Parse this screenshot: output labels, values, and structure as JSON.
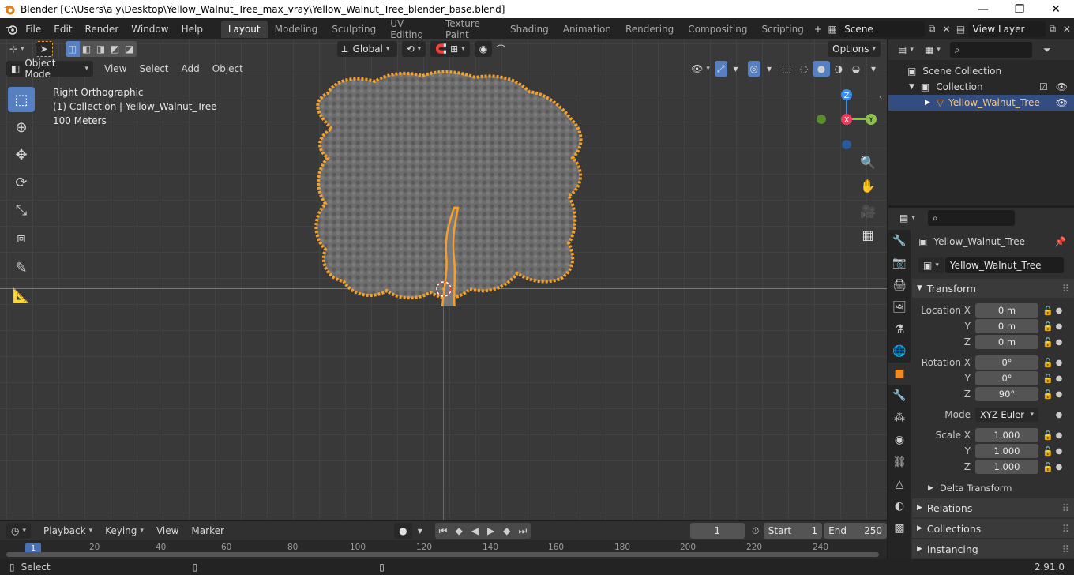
{
  "window": {
    "title": "Blender [C:\\Users\\a y\\Desktop\\Yellow_Walnut_Tree_max_vray\\Yellow_Walnut_Tree_blender_base.blend]",
    "minimize": "—",
    "maximize": "❐",
    "close": "✕"
  },
  "menu": [
    "File",
    "Edit",
    "Render",
    "Window",
    "Help"
  ],
  "workspaces": [
    "Layout",
    "Modeling",
    "Sculpting",
    "UV Editing",
    "Texture Paint",
    "Shading",
    "Animation",
    "Rendering",
    "Compositing",
    "Scripting"
  ],
  "scene": {
    "label": "Scene",
    "view_layer": "View Layer"
  },
  "viewport": {
    "mode": "Object Mode",
    "menus": [
      "View",
      "Select",
      "Add",
      "Object"
    ],
    "transform_orientation": "Global",
    "options": "Options",
    "view_name": "Right Orthographic",
    "collection_info": "(1) Collection | Yellow_Walnut_Tree",
    "scale": "100 Meters",
    "gizmo": {
      "z": "Z",
      "x": "X",
      "y": "Y"
    }
  },
  "outliner": {
    "root": "Scene Collection",
    "collection": "Collection",
    "object": "Yellow_Walnut_Tree"
  },
  "properties": {
    "object_name": "Yellow_Walnut_Tree",
    "data_name": "Yellow_Walnut_Tree",
    "transform_label": "Transform",
    "location": {
      "label": "Location X",
      "y_label": "Y",
      "z_label": "Z",
      "x": "0 m",
      "y": "0 m",
      "z": "0 m"
    },
    "rotation": {
      "label": "Rotation X",
      "y_label": "Y",
      "z_label": "Z",
      "x": "0°",
      "y": "0°",
      "z": "90°"
    },
    "mode_label": "Mode",
    "mode_value": "XYZ Euler",
    "scale": {
      "label": "Scale X",
      "y_label": "Y",
      "z_label": "Z",
      "x": "1.000",
      "y": "1.000",
      "z": "1.000"
    },
    "delta_transform": "Delta Transform",
    "relations": "Relations",
    "collections": "Collections",
    "instancing": "Instancing"
  },
  "timeline": {
    "menus": [
      "Playback",
      "Keying",
      "View",
      "Marker"
    ],
    "current_frame": "1",
    "start_label": "Start",
    "start": "1",
    "end_label": "End",
    "end": "250",
    "ticks": [
      "20",
      "40",
      "60",
      "80",
      "100",
      "120",
      "140",
      "160",
      "180",
      "200",
      "220",
      "240"
    ],
    "playhead": "1"
  },
  "status": {
    "left": "Select",
    "version": "2.91.0"
  },
  "colors": {
    "accent": "#f08a24",
    "selection": "#334d80",
    "active_tool": "#5680c2"
  }
}
